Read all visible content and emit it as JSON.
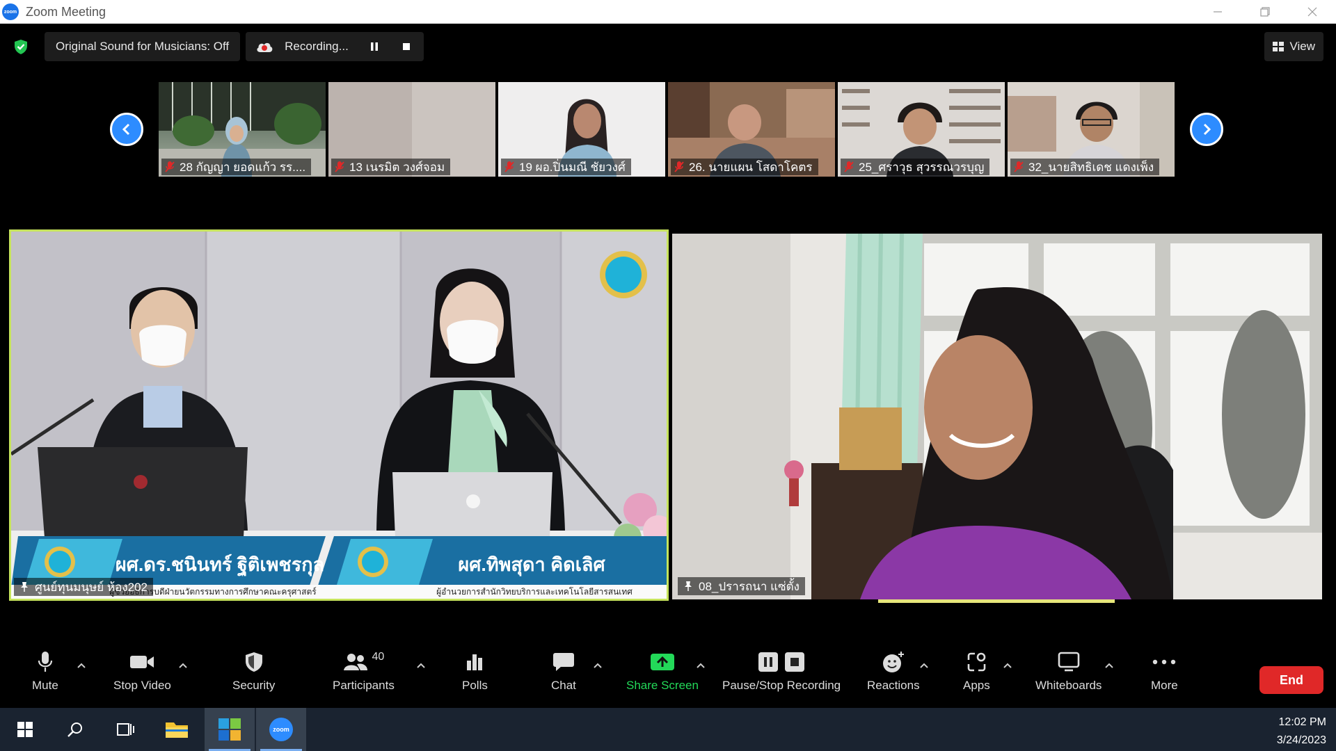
{
  "window": {
    "title": "Zoom Meeting",
    "app_icon_text": "zoom"
  },
  "topbar": {
    "original_sound": "Original Sound for Musicians: Off",
    "recording": "Recording...",
    "view": "View"
  },
  "gallery": [
    {
      "name": "28 กัญญา  ยอดแก้ว รร...."
    },
    {
      "name": "13 เนรมิต  วงศ์จอม"
    },
    {
      "name": "19 ผอ.ปิ่นมณี ชัยวงศ์"
    },
    {
      "name": "26. นายแผน  โสดาโคตร"
    },
    {
      "name": "25_ศราวุธ สุวรรณวรบุญ"
    },
    {
      "name": "32_นายสิทธิเดช  แดงเพ็ง"
    }
  ],
  "main_videos": [
    {
      "name": "ศูนย์ทุนมนุษย์ ห้อง202",
      "banner_left": "ผศ.ดร.ชนินทร์ ฐิติเพชรกุล",
      "banner_left_sub": "ผู้ช่วยอธิการบดีฝ่ายนวัตกรรมทางการศึกษาคณะครุศาสตร์",
      "banner_right": "ผศ.ทิพสุดา คิดเลิศ",
      "banner_right_sub": "ผู้อำนวยการสำนักวิทยบริการและเทคโนโลยีสารสนเทศ"
    },
    {
      "name": "08_ปรารถนา แซ่ตั้ง"
    }
  ],
  "toolbar": {
    "mute": "Mute",
    "stop_video": "Stop Video",
    "security": "Security",
    "participants": "Participants",
    "participants_count": "40",
    "polls": "Polls",
    "chat": "Chat",
    "share_screen": "Share Screen",
    "pause_stop_recording": "Pause/Stop Recording",
    "reactions": "Reactions",
    "apps": "Apps",
    "whiteboards": "Whiteboards",
    "more": "More",
    "end": "End"
  },
  "taskbar": {
    "time": "12:02 PM",
    "date": "3/24/2023",
    "zoom_icon_text": "zoom"
  },
  "colors": {
    "accent_blue": "#2d8cff",
    "share_green": "#23d959",
    "end_red": "#e02828",
    "active_speaker_border": "#c6e35c",
    "security_green": "#23c552"
  }
}
